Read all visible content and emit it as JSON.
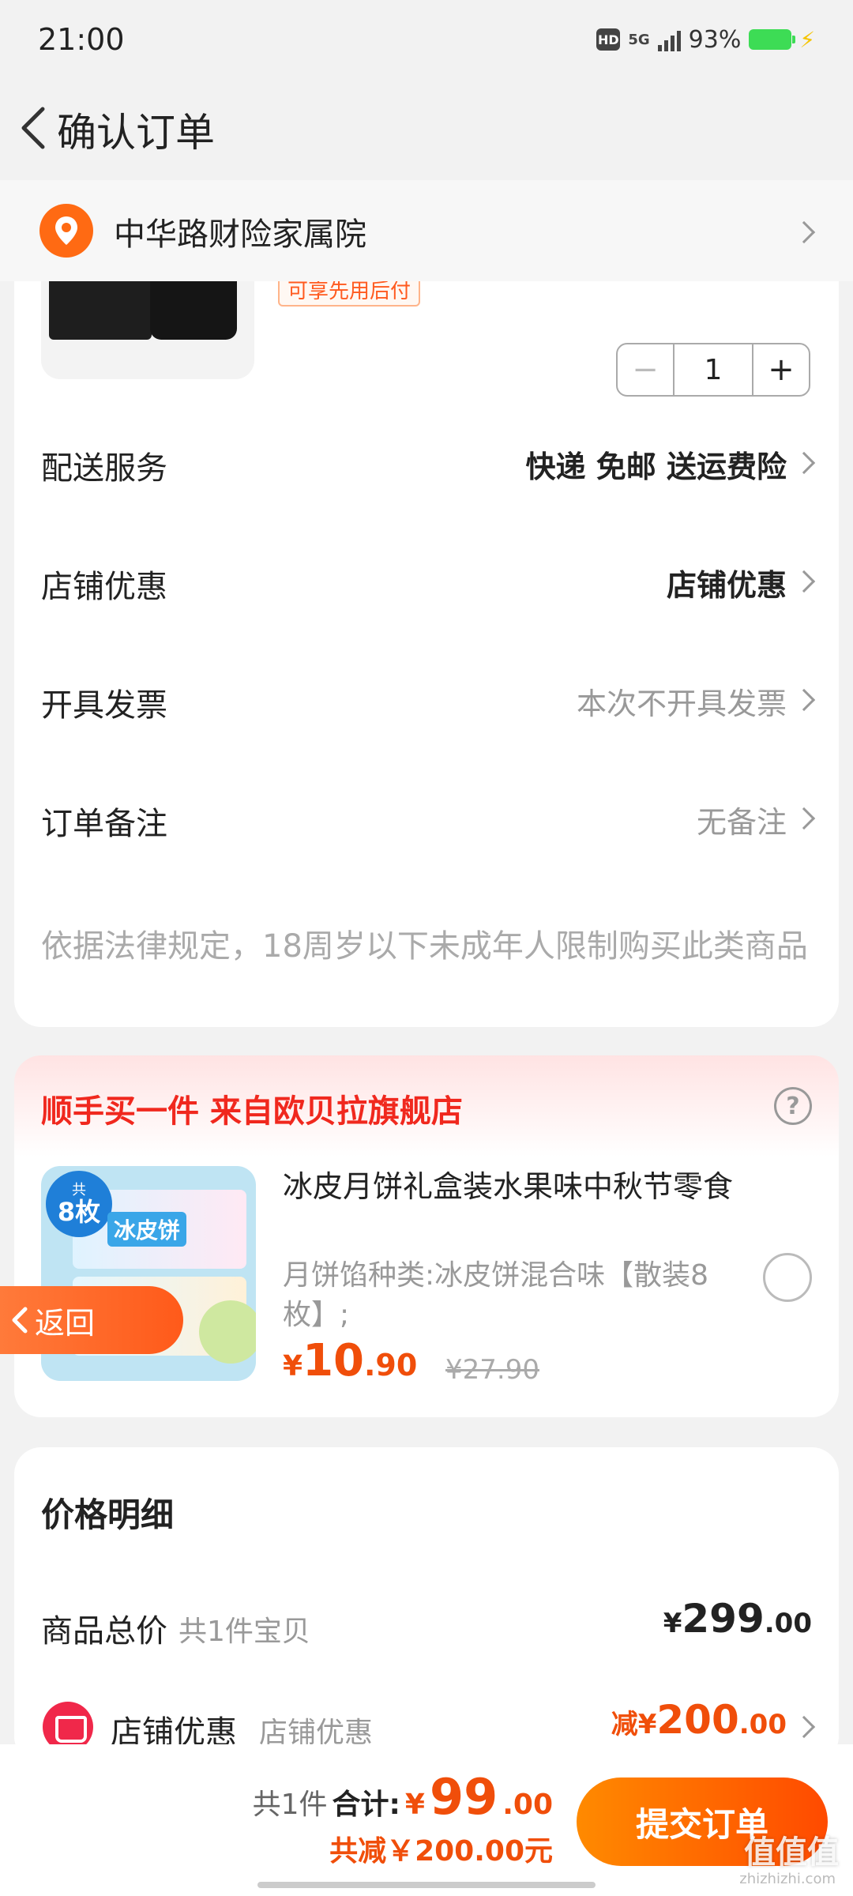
{
  "status_bar": {
    "time": "21:00",
    "network": "5G",
    "battery": "93%",
    "hd": "HD"
  },
  "nav": {
    "title": "确认订单"
  },
  "address": {
    "text": "中华路财险家属院"
  },
  "order_item": {
    "tag": "可享先用后付",
    "quantity": "1",
    "minus": "−",
    "plus": "+"
  },
  "order_rows": [
    {
      "label": "配送服务",
      "value": "快递 免邮 送运费险"
    },
    {
      "label": "店铺优惠",
      "value": "店铺优惠"
    },
    {
      "label": "开具发票",
      "value": "本次不开具发票"
    },
    {
      "label": "订单备注",
      "value": "无备注"
    }
  ],
  "legal_notice": "依据法律规定，18周岁以下未成年人限制购买此类商品",
  "addon": {
    "title": "顺手买一件  来自欧贝拉旗舰店",
    "help": "?",
    "name": "冰皮月饼礼盒装水果味中秋节零食",
    "spec": "月饼馅种类:冰皮饼混合味【散装8枚】;",
    "price_currency": "¥",
    "price_int": "10",
    "price_dec": ".90",
    "original_price": "¥27.90",
    "badge_top": "共",
    "badge_main": "8枚",
    "package_label": "冰皮饼"
  },
  "float_back": {
    "label": "返回"
  },
  "price_detail": {
    "title": "价格明细",
    "total_label": "商品总价",
    "total_sub": "共1件宝贝",
    "total_currency": "¥",
    "total_int": "299",
    "total_dec": ".00",
    "discount_label": "店铺优惠",
    "discount_sub": "店铺优惠",
    "discount_prefix": "减",
    "discount_currency": "¥",
    "discount_int": "200",
    "discount_dec": ".00"
  },
  "bottom_bar": {
    "count": "共1件",
    "sum_label": "合计:",
    "sum_currency": "¥",
    "sum_int": "99",
    "sum_dec": ".00",
    "saved": "共减￥200.00元",
    "submit": "提交订单"
  },
  "watermark": {
    "text": "值值值",
    "site": "zhizhizhi.com"
  },
  "colors": {
    "accent": "#ff5a1f",
    "price": "#f04e0a",
    "addon_title": "#f0281e",
    "background": "#f2f2f2"
  }
}
